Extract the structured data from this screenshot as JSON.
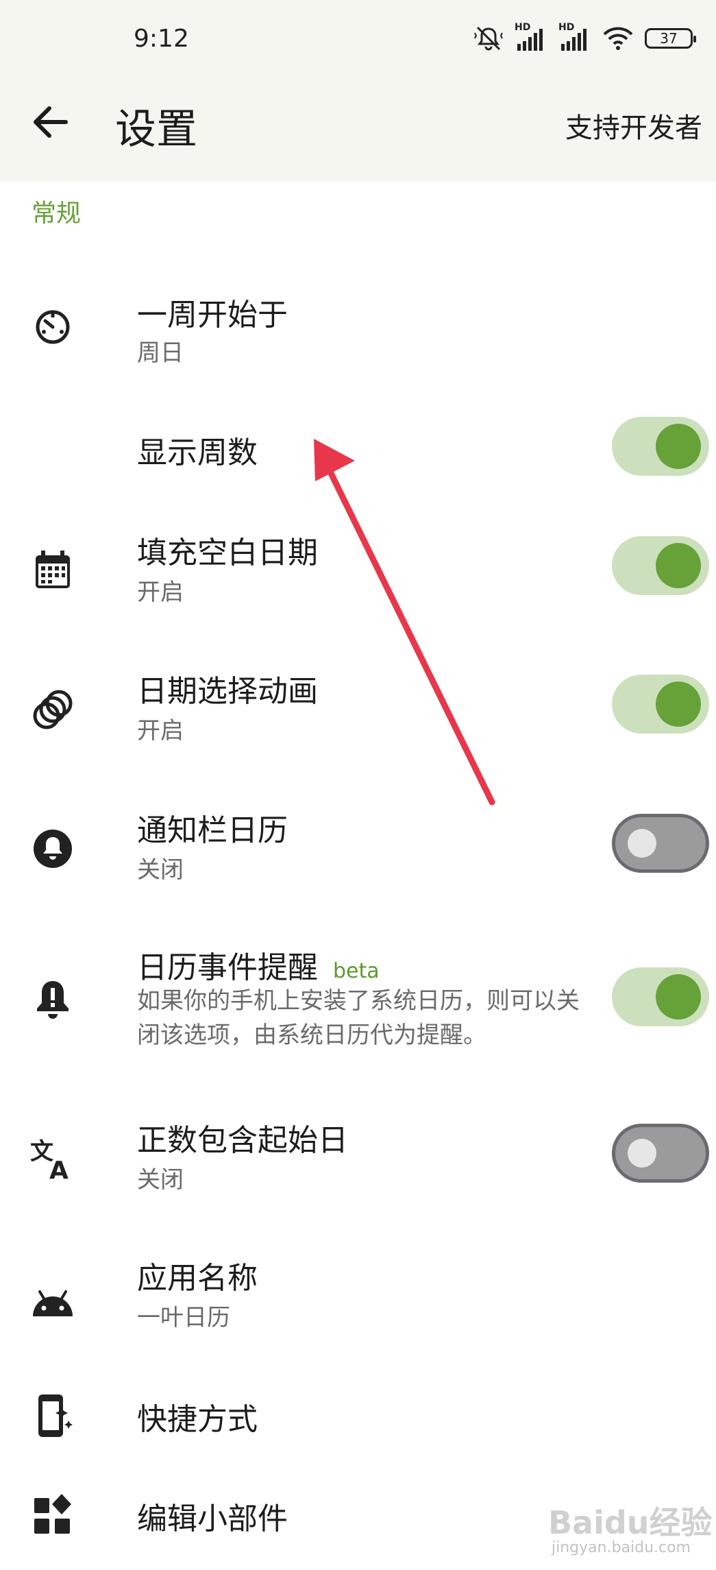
{
  "status_bar": {
    "time": "9:12",
    "hd1": "HD",
    "hd2": "HD",
    "battery": "37"
  },
  "header": {
    "title": "设置",
    "support": "支持开发者",
    "back_icon": "arrow-left-icon"
  },
  "section": {
    "title": "常规"
  },
  "items": [
    {
      "label": "一周开始于",
      "sub": "周日",
      "icon": "timer-icon"
    },
    {
      "label": "显示周数",
      "switch": "on"
    },
    {
      "label": "填充空白日期",
      "sub": "开启",
      "icon": "calendar-icon",
      "switch": "on"
    },
    {
      "label": "日期选择动画",
      "sub": "开启",
      "icon": "rings-icon",
      "switch": "on"
    },
    {
      "label": "通知栏日历",
      "sub": "关闭",
      "icon": "notification-icon",
      "switch": "off"
    },
    {
      "label": "日历事件提醒",
      "badge": "beta",
      "desc": "如果你的手机上安装了系统日历，则可以关闭该选项，由系统日历代为提醒。",
      "icon": "alert-bell-icon",
      "switch": "on"
    },
    {
      "label": "正数包含起始日",
      "sub": "关闭",
      "icon": "translate-icon",
      "switch": "off"
    },
    {
      "label": "应用名称",
      "sub": "一叶日历",
      "icon": "android-icon"
    },
    {
      "label": "快捷方式",
      "icon": "shortcut-icon"
    },
    {
      "label": "编辑小部件",
      "icon": "widgets-icon"
    }
  ],
  "watermark": {
    "text": "Baidu经验",
    "sub": "jingyan.baidu.com"
  },
  "colors": {
    "accent": "#66a237",
    "switch_track_on": "#cde0bd",
    "switch_off": "#9b9b9b",
    "arrow": "#e8374a"
  }
}
